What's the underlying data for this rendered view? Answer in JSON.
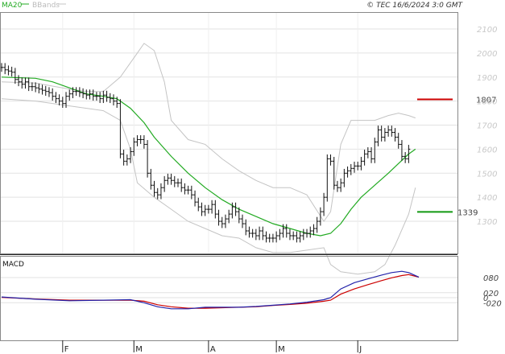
{
  "header": {
    "legend_ma": "MA20",
    "legend_bb": "BBands",
    "copyright": "© TEC 16/6/2024 3:0 GMT"
  },
  "macd_label": "MACD",
  "colors": {
    "ma": "#22aa22",
    "bbands": "#c4c4c4",
    "bars": "#111111",
    "resistance": "#cc0000",
    "support": "#119911",
    "macd_line": "#2222aa",
    "signal_line": "#cc0000",
    "grid": "#e2e2e2"
  },
  "chart_data": [
    {
      "type": "ohlc",
      "ylim": [
        1200,
        2150
      ],
      "y_ticks": [
        "2100",
        "2000",
        "1900",
        "1800",
        "1700",
        "1600",
        "1500",
        "1400",
        "1300"
      ],
      "y_tick_values": [
        2100,
        2000,
        1900,
        1800,
        1700,
        1600,
        1500,
        1400,
        1300
      ],
      "resistance": {
        "value": 1807,
        "label": "1807"
      },
      "support": {
        "value": 1339,
        "label": "1339"
      },
      "x_months": [
        {
          "label": "F",
          "day": 18
        },
        {
          "label": "M",
          "day": 39
        },
        {
          "label": "A",
          "day": 61
        },
        {
          "label": "M",
          "day": 81
        },
        {
          "label": "J",
          "day": 105
        }
      ],
      "n_days": 124,
      "close": [
        1940,
        1930,
        1925,
        1920,
        1890,
        1880,
        1870,
        1880,
        1860,
        1860,
        1855,
        1850,
        1845,
        1840,
        1835,
        1820,
        1810,
        1800,
        1790,
        1820,
        1830,
        1840,
        1840,
        1835,
        1830,
        1825,
        1830,
        1820,
        1820,
        1810,
        1825,
        1815,
        1810,
        1800,
        1790,
        1580,
        1550,
        1560,
        1590,
        1630,
        1640,
        1640,
        1620,
        1500,
        1450,
        1420,
        1410,
        1440,
        1470,
        1480,
        1470,
        1460,
        1460,
        1440,
        1430,
        1430,
        1410,
        1380,
        1360,
        1340,
        1350,
        1350,
        1370,
        1330,
        1300,
        1290,
        1310,
        1330,
        1360,
        1340,
        1310,
        1290,
        1260,
        1250,
        1250,
        1240,
        1260,
        1240,
        1230,
        1230,
        1230,
        1240,
        1250,
        1270,
        1250,
        1240,
        1240,
        1230,
        1240,
        1250,
        1250,
        1260,
        1270,
        1300,
        1340,
        1400,
        1560,
        1550,
        1450,
        1440,
        1460,
        1500,
        1510,
        1520,
        1530,
        1530,
        1550,
        1580,
        1590,
        1560,
        1630,
        1680,
        1650,
        1670,
        1680,
        1670,
        1650,
        1620,
        1570,
        1560,
        1600
      ],
      "bb_upper_points": [
        [
          0,
          1880
        ],
        [
          10,
          1875
        ],
        [
          20,
          1850
        ],
        [
          25,
          1840
        ],
        [
          30,
          1840
        ],
        [
          35,
          1900
        ],
        [
          40,
          2000
        ],
        [
          42,
          2040
        ],
        [
          45,
          2010
        ],
        [
          48,
          1880
        ],
        [
          50,
          1720
        ],
        [
          55,
          1640
        ],
        [
          60,
          1620
        ],
        [
          65,
          1560
        ],
        [
          70,
          1510
        ],
        [
          75,
          1470
        ],
        [
          80,
          1440
        ],
        [
          85,
          1440
        ],
        [
          90,
          1410
        ],
        [
          95,
          1300
        ],
        [
          97,
          1340
        ],
        [
          100,
          1620
        ],
        [
          103,
          1720
        ],
        [
          106,
          1720
        ],
        [
          110,
          1720
        ],
        [
          114,
          1740
        ],
        [
          117,
          1750
        ],
        [
          120,
          1740
        ],
        [
          122,
          1730
        ]
      ],
      "bb_lower_points": [
        [
          0,
          1810
        ],
        [
          10,
          1800
        ],
        [
          20,
          1780
        ],
        [
          30,
          1760
        ],
        [
          35,
          1720
        ],
        [
          38,
          1600
        ],
        [
          40,
          1460
        ],
        [
          45,
          1400
        ],
        [
          50,
          1350
        ],
        [
          55,
          1300
        ],
        [
          60,
          1270
        ],
        [
          65,
          1240
        ],
        [
          70,
          1230
        ],
        [
          75,
          1190
        ],
        [
          80,
          1170
        ],
        [
          85,
          1170
        ],
        [
          90,
          1180
        ],
        [
          95,
          1190
        ],
        [
          97,
          1120
        ],
        [
          100,
          1090
        ],
        [
          105,
          1080
        ],
        [
          110,
          1090
        ],
        [
          113,
          1120
        ],
        [
          116,
          1200
        ],
        [
          120,
          1330
        ],
        [
          122,
          1440
        ]
      ],
      "ma20_points": [
        [
          0,
          1900
        ],
        [
          10,
          1895
        ],
        [
          15,
          1880
        ],
        [
          20,
          1855
        ],
        [
          25,
          1830
        ],
        [
          30,
          1820
        ],
        [
          34,
          1810
        ],
        [
          38,
          1770
        ],
        [
          42,
          1710
        ],
        [
          45,
          1650
        ],
        [
          50,
          1570
        ],
        [
          55,
          1500
        ],
        [
          60,
          1440
        ],
        [
          65,
          1390
        ],
        [
          70,
          1350
        ],
        [
          75,
          1320
        ],
        [
          80,
          1290
        ],
        [
          85,
          1270
        ],
        [
          90,
          1250
        ],
        [
          94,
          1240
        ],
        [
          97,
          1250
        ],
        [
          100,
          1290
        ],
        [
          103,
          1350
        ],
        [
          106,
          1400
        ],
        [
          110,
          1450
        ],
        [
          114,
          1500
        ],
        [
          117,
          1540
        ],
        [
          120,
          1580
        ],
        [
          122,
          1600
        ]
      ]
    },
    {
      "type": "line",
      "title": "MACD",
      "ylim": [
        -60,
        120
      ],
      "y_ticks": [
        "080",
        "020",
        "0",
        "-020"
      ],
      "y_tick_values": [
        80,
        20,
        0,
        -20
      ],
      "series": [
        {
          "key": "macd",
          "points": [
            [
              0,
              3
            ],
            [
              10,
              -6
            ],
            [
              20,
              -12
            ],
            [
              30,
              -10
            ],
            [
              38,
              -8
            ],
            [
              42,
              -20
            ],
            [
              46,
              -36
            ],
            [
              50,
              -44
            ],
            [
              55,
              -44
            ],
            [
              60,
              -38
            ],
            [
              65,
              -38
            ],
            [
              70,
              -38
            ],
            [
              75,
              -35
            ],
            [
              80,
              -30
            ],
            [
              85,
              -25
            ],
            [
              90,
              -18
            ],
            [
              95,
              -8
            ],
            [
              97,
              0
            ],
            [
              100,
              35
            ],
            [
              104,
              60
            ],
            [
              108,
              75
            ],
            [
              112,
              90
            ],
            [
              115,
              100
            ],
            [
              118,
              105
            ],
            [
              120,
              100
            ],
            [
              123,
              82
            ]
          ]
        },
        {
          "key": "signal",
          "points": [
            [
              0,
              1
            ],
            [
              10,
              -5
            ],
            [
              20,
              -10
            ],
            [
              30,
              -10
            ],
            [
              38,
              -10
            ],
            [
              42,
              -14
            ],
            [
              46,
              -28
            ],
            [
              50,
              -36
            ],
            [
              55,
              -42
            ],
            [
              60,
              -42
            ],
            [
              65,
              -40
            ],
            [
              70,
              -38
            ],
            [
              75,
              -36
            ],
            [
              80,
              -31
            ],
            [
              85,
              -27
            ],
            [
              90,
              -22
            ],
            [
              95,
              -14
            ],
            [
              97,
              -10
            ],
            [
              100,
              14
            ],
            [
              104,
              35
            ],
            [
              108,
              52
            ],
            [
              112,
              68
            ],
            [
              115,
              79
            ],
            [
              118,
              88
            ],
            [
              120,
              92
            ],
            [
              123,
              82
            ]
          ]
        }
      ]
    }
  ]
}
